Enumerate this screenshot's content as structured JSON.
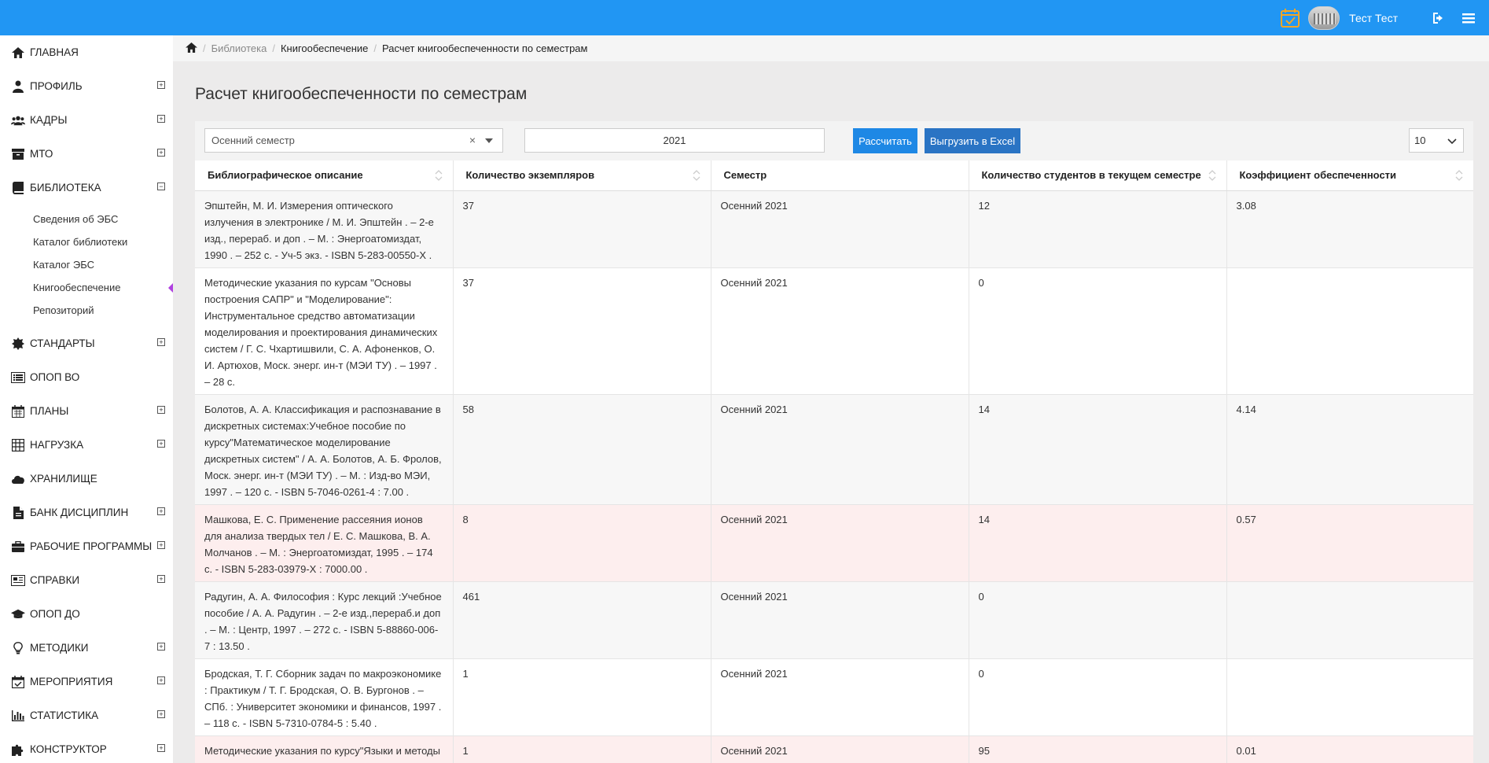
{
  "header": {
    "user_name": "Тест Тест",
    "accent_color": "#2196f3",
    "icons": [
      "calendar-check-icon",
      "avatar",
      "logout-icon",
      "menu-icon"
    ]
  },
  "sidebar": {
    "items": [
      {
        "label": "ГЛАВНАЯ",
        "icon": "home-icon",
        "expandable": false
      },
      {
        "label": "ПРОФИЛЬ",
        "icon": "user-icon",
        "expandable": true,
        "toggle": "⊞"
      },
      {
        "label": "КАДРЫ",
        "icon": "users-icon",
        "expandable": true,
        "toggle": "⊞"
      },
      {
        "label": "МТО",
        "icon": "archive-icon",
        "expandable": true,
        "toggle": "⊞"
      },
      {
        "label": "БИБЛИОТЕКА",
        "icon": "book-icon",
        "expandable": true,
        "toggle": "⊟"
      },
      {
        "label": "СТАНДАРТЫ",
        "icon": "certificate-icon",
        "expandable": true,
        "toggle": "⊞"
      },
      {
        "label": "ОПОП ВО",
        "icon": "list-alt-icon",
        "expandable": false
      },
      {
        "label": "ПЛАНЫ",
        "icon": "calendar-icon",
        "expandable": true,
        "toggle": "⊞"
      },
      {
        "label": "НАГРУЗКА",
        "icon": "table-icon",
        "expandable": true,
        "toggle": "⊞"
      },
      {
        "label": "ХРАНИЛИЩЕ",
        "icon": "cloud-icon",
        "expandable": false
      },
      {
        "label": "БАНК ДИСЦИПЛИН",
        "icon": "file-icon",
        "expandable": true,
        "toggle": "⊞"
      },
      {
        "label": "РАБОЧИЕ ПРОГРАММЫ",
        "icon": "briefcase-icon",
        "expandable": true,
        "toggle": "⊞"
      },
      {
        "label": "СПРАВКИ",
        "icon": "newspaper-icon",
        "expandable": true,
        "toggle": "⊞"
      },
      {
        "label": "ОПОП ДО",
        "icon": "graduation-cap-icon",
        "expandable": false
      },
      {
        "label": "МЕТОДИКИ",
        "icon": "lightbulb-icon",
        "expandable": true,
        "toggle": "⊞"
      },
      {
        "label": "МЕРОПРИЯТИЯ",
        "icon": "calendar-check-icon",
        "expandable": true,
        "toggle": "⊞"
      },
      {
        "label": "СТАТИСТИКА",
        "icon": "bar-chart-icon",
        "expandable": true,
        "toggle": "⊞"
      },
      {
        "label": "КОНСТРУКТОР",
        "icon": "puzzle-icon",
        "expandable": true,
        "toggle": "⊞"
      }
    ],
    "library_sub": [
      {
        "label": "Сведения об ЭБС"
      },
      {
        "label": "Каталог библиотеки"
      },
      {
        "label": "Каталог ЭБС"
      },
      {
        "label": "Книгообеспечение",
        "active": true
      },
      {
        "label": "Репозиторий"
      }
    ]
  },
  "breadcrumb": {
    "home_icon": "home-icon",
    "items": [
      "Библиотека",
      "Книгообеспечение",
      "Расчет книгообеспеченности по семестрам"
    ]
  },
  "page": {
    "title": "Расчет книгообеспеченности по семестрам"
  },
  "filters": {
    "semester_value": "Осенний семестр",
    "clear_symbol": "×",
    "year_value": "2021",
    "calculate_label": "Рассчитать",
    "export_label": "Выгрузить в Excel",
    "page_size": "10"
  },
  "table": {
    "columns": [
      "Библиографическое описание",
      "Количество экземпляров",
      "Семестр",
      "Количество студентов в текущем семестре",
      "Коэффициент обеспеченности"
    ],
    "rows": [
      {
        "description": "Эпштейн, М. И. Измерения оптического излучения в электронике / М. И. Эпштейн . – 2-е изд., перераб. и доп . – М. : Энергоатомиздат, 1990 . – 252 с. - Уч-5 экз. - ISBN 5-283-00550-X .",
        "copies": "37",
        "semester": "Осенний 2021",
        "students": "12",
        "coef": "3.08",
        "style": "odd"
      },
      {
        "description": "Методические указания по курсам \"Основы построения САПР\" и \"Моделирование\": Инструментальное средство автоматизации моделирования и проектирования динамических систем / Г. С. Чхартишвили, С. А. Афоненков, О. И. Артюхов, Моск. энерг. ин-т (МЭИ ТУ) . – 1997 . – 28 с.",
        "copies": "37",
        "semester": "Осенний 2021",
        "students": "0",
        "coef": "",
        "style": "even"
      },
      {
        "description": "Болотов, А. А. Классификация и распознавание в дискретных системах:Учебное пособие по курсу\"Математическое моделирование дискретных систем\" / А. А. Болотов, А. Б. Фролов, Моск. энерг. ин-т (МЭИ ТУ) . – М. : Изд-во МЭИ, 1997 . – 120 с. - ISBN 5-7046-0261-4 : 7.00 .",
        "copies": "58",
        "semester": "Осенний 2021",
        "students": "14",
        "coef": "4.14",
        "style": "odd"
      },
      {
        "description": "Машкова, Е. С. Применение рассеяния ионов для анализа твердых тел / Е. С. Машкова, В. А. Молчанов . – М. : Энергоатомиздат, 1995 . – 174 с. - ISBN 5-283-03979-X : 7000.00 .",
        "copies": "8",
        "semester": "Осенний 2021",
        "students": "14",
        "coef": "0.57",
        "style": "warn"
      },
      {
        "description": "Радугин, А. А. Философия : Курс лекций :Учебное пособие / А. А. Радугин . – 2-е изд.,перераб.и доп . – М. : Центр, 1997 . – 272 с. - ISBN 5-88860-006-7 : 13.50 .",
        "copies": "461",
        "semester": "Осенний 2021",
        "students": "0",
        "coef": "",
        "style": "odd"
      },
      {
        "description": "Бродская, Т. Г. Сборник задач по макроэкономике : Практикум / Т. Г. Бродская, О. В. Бургонов . – СПб. : Университет экономики и финансов, 1997 . – 118 с. - ISBN 5-7310-0784-5 : 5.40 .",
        "copies": "1",
        "semester": "Осенний 2021",
        "students": "0",
        "coef": "",
        "style": "even"
      },
      {
        "description": "Методические указания по курсу\"Языки и методы",
        "copies": "1",
        "semester": "Осенний 2021",
        "students": "95",
        "coef": "0.01",
        "style": "warn"
      }
    ]
  }
}
